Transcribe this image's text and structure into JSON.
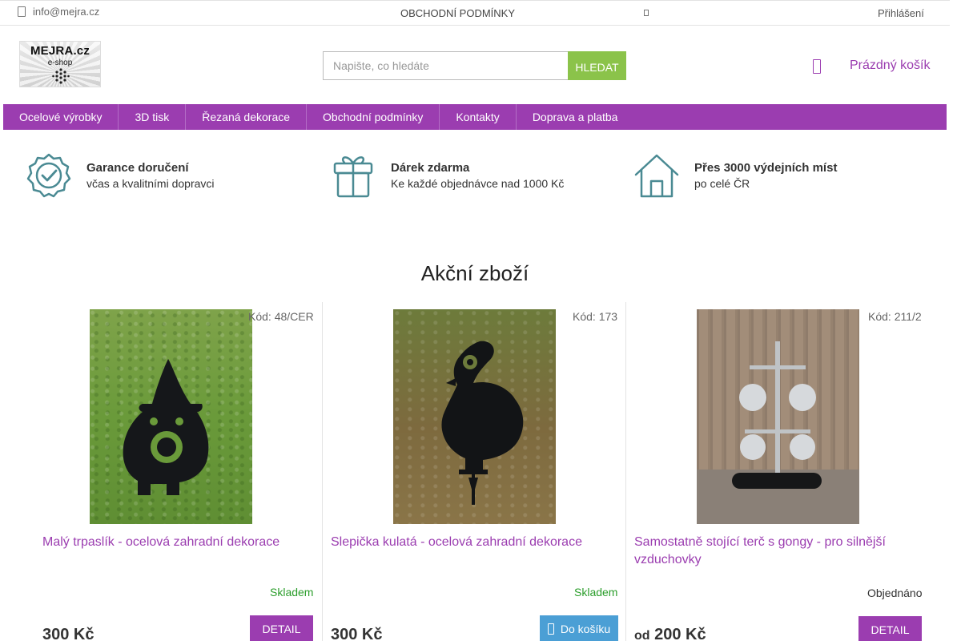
{
  "topbar": {
    "email": "info@mejra.cz",
    "terms": "OBCHODNÍ PODMÍNKY",
    "login": "Přihlášení"
  },
  "logo": {
    "line1": "MEJRA.cz",
    "line2": "e-shop"
  },
  "search": {
    "placeholder": "Napište, co hledáte",
    "value": "",
    "button": "HLEDAT"
  },
  "cart": {
    "label": "Prázdný košík"
  },
  "nav": {
    "items": [
      "Ocelové výrobky",
      "3D tisk",
      "Řezaná dekorace",
      "Obchodní podmínky",
      "Kontakty",
      "Doprava a platba"
    ]
  },
  "benefits": [
    {
      "icon": "badge-check-icon",
      "title": "Garance doručení",
      "subtitle": "včas a kvalitními dopravci"
    },
    {
      "icon": "gift-icon",
      "title": "Dárek zdarma",
      "subtitle": "Ke každé objednávce nad 1000 Kč"
    },
    {
      "icon": "house-icon",
      "title": "Přes 3000 výdejních míst",
      "subtitle": "po celé ČR"
    }
  ],
  "section_title": "Akční zboží",
  "products": [
    {
      "code": "Kód: 48/CER",
      "name": "Malý trpaslík - ocelová zahradní dekorace",
      "stock": "Skladem",
      "price_prefix": "",
      "price": "300 Kč",
      "button": "DETAIL"
    },
    {
      "code": "Kód: 173",
      "name": "Slepička kulatá - ocelová zahradní dekorace",
      "stock": "Skladem",
      "price_prefix": "",
      "price": "300 Kč",
      "button": "Do košíku"
    },
    {
      "code": "Kód: 211/2",
      "name": "Samostatně stojící terč s gongy - pro silnější vzduchovky",
      "stock": "Objednáno",
      "price_prefix": "od",
      "price": "200 Kč",
      "button": "DETAIL"
    }
  ],
  "colors": {
    "brand": "#9b3db0",
    "accent_green": "#8bc34a",
    "cart_button": "#4b9fd5",
    "stock_green": "#2a9d2a",
    "icon_teal": "#4a8a93"
  }
}
